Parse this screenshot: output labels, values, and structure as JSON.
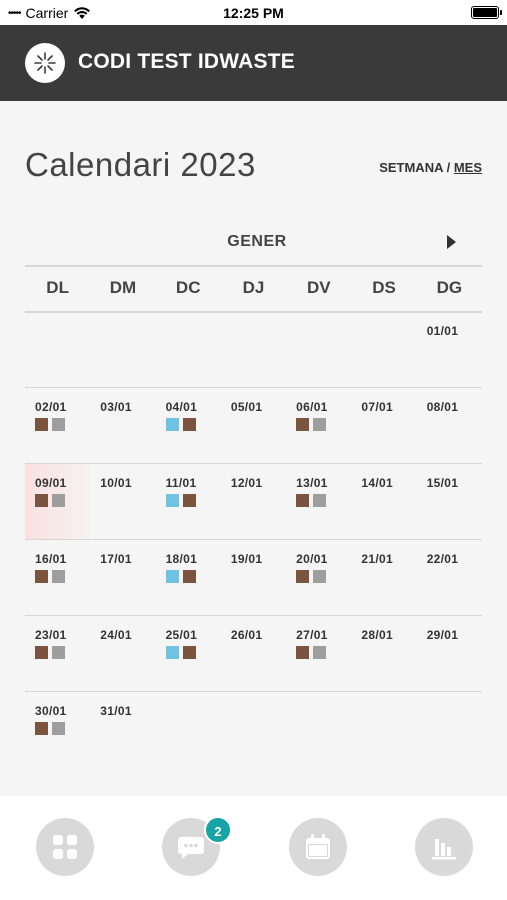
{
  "status_bar": {
    "carrier": "Carrier",
    "time": "12:25 PM"
  },
  "header": {
    "app_title": "CODI TEST IDWASTE",
    "logo_icon": "recycling-logo-icon"
  },
  "page": {
    "title": "Calendari 2023",
    "view_week": "SETMANA",
    "separator": " / ",
    "view_month": "MES"
  },
  "month": {
    "name": "GENER",
    "next_icon": "triangle-right-icon"
  },
  "weekdays": [
    "DL",
    "DM",
    "DC",
    "DJ",
    "DV",
    "DS",
    "DG"
  ],
  "colors": {
    "brown": "#7a543f",
    "gray": "#9e9e9e",
    "blue": "#6ec3e3"
  },
  "weeks": [
    [
      null,
      null,
      null,
      null,
      null,
      null,
      {
        "date": "01/01",
        "markers": []
      }
    ],
    [
      {
        "date": "02/01",
        "markers": [
          "brown",
          "gray"
        ]
      },
      {
        "date": "03/01",
        "markers": []
      },
      {
        "date": "04/01",
        "markers": [
          "blue",
          "brown"
        ]
      },
      {
        "date": "05/01",
        "markers": []
      },
      {
        "date": "06/01",
        "markers": [
          "brown",
          "gray"
        ]
      },
      {
        "date": "07/01",
        "markers": []
      },
      {
        "date": "08/01",
        "markers": []
      }
    ],
    [
      {
        "date": "09/01",
        "markers": [
          "brown",
          "gray"
        ],
        "today": true
      },
      {
        "date": "10/01",
        "markers": []
      },
      {
        "date": "11/01",
        "markers": [
          "blue",
          "brown"
        ]
      },
      {
        "date": "12/01",
        "markers": []
      },
      {
        "date": "13/01",
        "markers": [
          "brown",
          "gray"
        ]
      },
      {
        "date": "14/01",
        "markers": []
      },
      {
        "date": "15/01",
        "markers": []
      }
    ],
    [
      {
        "date": "16/01",
        "markers": [
          "brown",
          "gray"
        ]
      },
      {
        "date": "17/01",
        "markers": []
      },
      {
        "date": "18/01",
        "markers": [
          "blue",
          "brown"
        ]
      },
      {
        "date": "19/01",
        "markers": []
      },
      {
        "date": "20/01",
        "markers": [
          "brown",
          "gray"
        ]
      },
      {
        "date": "21/01",
        "markers": []
      },
      {
        "date": "22/01",
        "markers": []
      }
    ],
    [
      {
        "date": "23/01",
        "markers": [
          "brown",
          "gray"
        ]
      },
      {
        "date": "24/01",
        "markers": []
      },
      {
        "date": "25/01",
        "markers": [
          "blue",
          "brown"
        ]
      },
      {
        "date": "26/01",
        "markers": []
      },
      {
        "date": "27/01",
        "markers": [
          "brown",
          "gray"
        ]
      },
      {
        "date": "28/01",
        "markers": []
      },
      {
        "date": "29/01",
        "markers": []
      }
    ],
    [
      {
        "date": "30/01",
        "markers": [
          "brown",
          "gray"
        ]
      },
      {
        "date": "31/01",
        "markers": []
      },
      null,
      null,
      null,
      null,
      null
    ]
  ],
  "bottom_nav": {
    "items": [
      {
        "icon": "grid-icon"
      },
      {
        "icon": "chat-icon",
        "badge": "2"
      },
      {
        "icon": "calendar-icon"
      },
      {
        "icon": "bar-chart-icon"
      }
    ]
  }
}
